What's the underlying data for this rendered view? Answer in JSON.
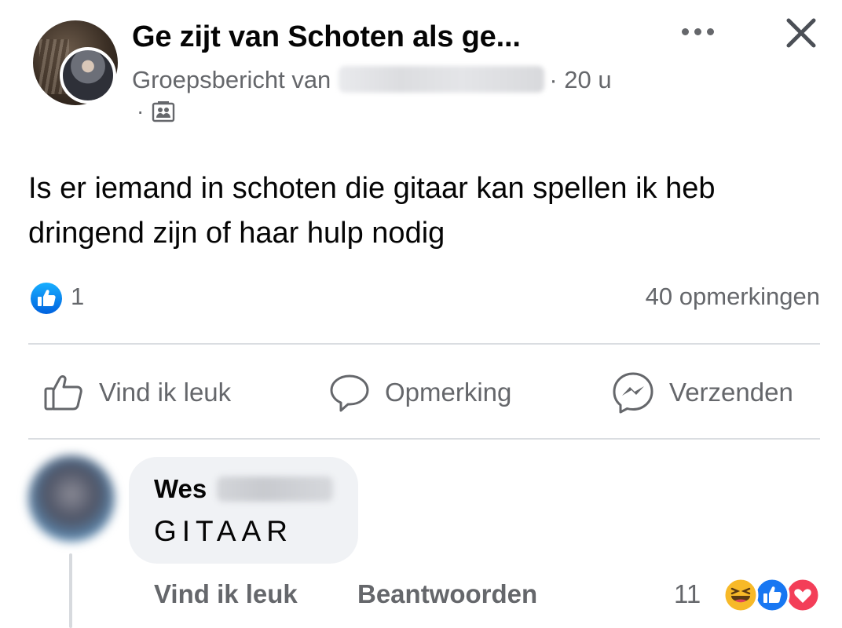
{
  "header": {
    "group_title": "Ge zijt van Schoten als ge...",
    "meta_prefix": "Groepsbericht van",
    "time": "· 20 u",
    "dot": "·"
  },
  "post": {
    "text": "Is er iemand in schoten die gitaar kan spellen ik heb dringend zijn of haar hulp nodig"
  },
  "stats": {
    "reaction_count": "1",
    "comment_count": "40 opmerkingen"
  },
  "actions": {
    "like": "Vind ik leuk",
    "comment": "Opmerking",
    "send": "Verzenden"
  },
  "comment": {
    "author_first": "Wes",
    "text": "GITAAR",
    "like": "Vind ik leuk",
    "reply": "Beantwoorden",
    "reaction_count": "11",
    "reactions": [
      "haha-icon",
      "like-icon",
      "love-icon"
    ]
  },
  "colors": {
    "facebook_blue": "#1877f2",
    "love_red": "#f33e58",
    "haha_yellow": "#f7b928",
    "secondary_text": "#65676b"
  }
}
